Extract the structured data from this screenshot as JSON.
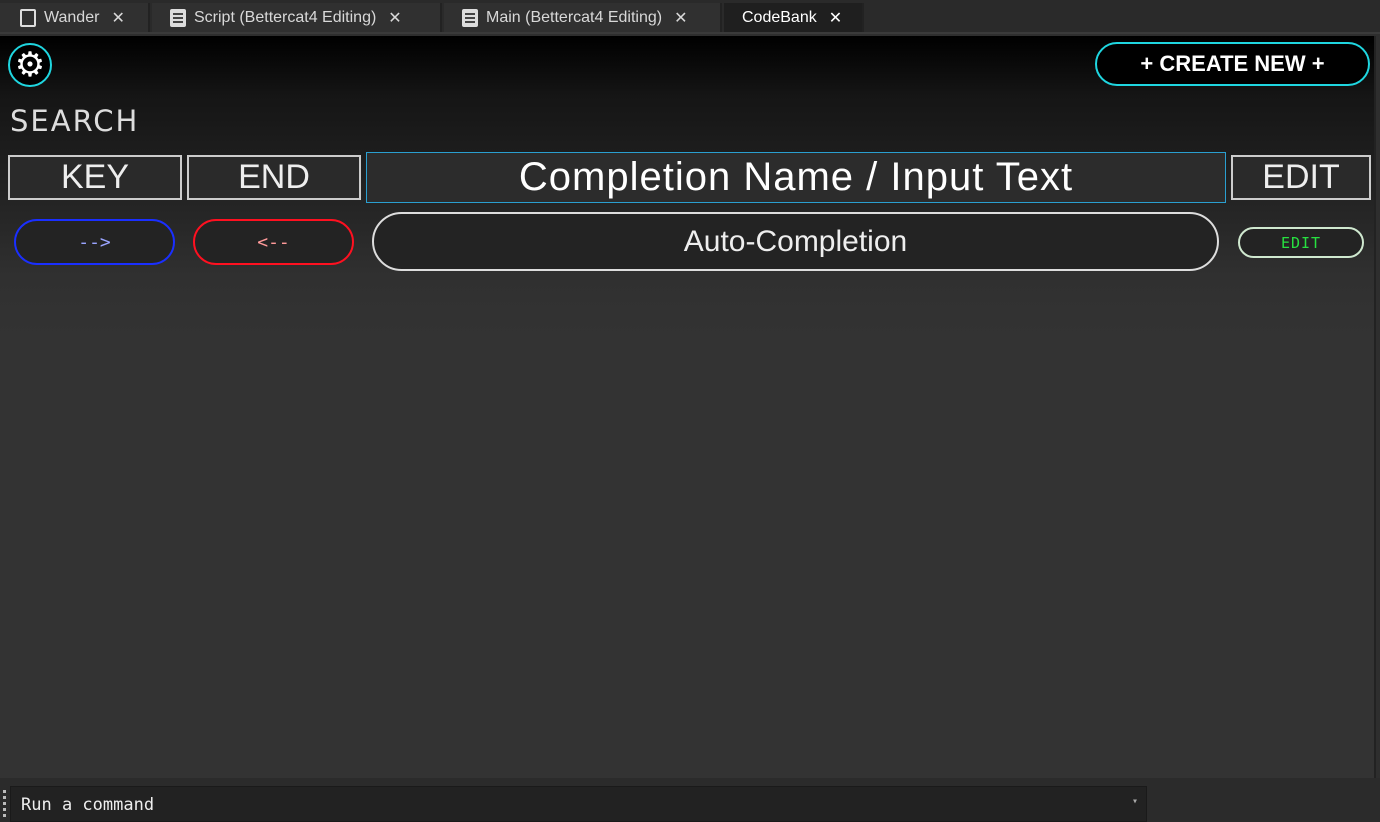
{
  "tabs": [
    {
      "label": "Wander",
      "icon": "script-cloud-icon"
    },
    {
      "label": "Script (Bettercat4 Editing)",
      "icon": "script-icon"
    },
    {
      "label": "Main (Bettercat4 Editing)",
      "icon": "script-icon"
    },
    {
      "label": "CodeBank",
      "active": true
    }
  ],
  "close_glyph": "✕",
  "settings_glyph": "⚙",
  "create_new": "+ CREATE NEW +",
  "search_label": "SEARCH",
  "headers": {
    "key": "KEY",
    "end": "END",
    "input": "Completion Name / Input Text",
    "edit": "EDIT"
  },
  "row": {
    "key": "-->",
    "end": "<--",
    "completion": "Auto-Completion",
    "edit": "EDIT"
  },
  "colors": {
    "accent": "#1fd6e0",
    "key": "#1a2fff",
    "end": "#ff1020",
    "edit": "#27e040"
  },
  "command_bar": {
    "placeholder": "Run a command",
    "caret": "▾"
  }
}
